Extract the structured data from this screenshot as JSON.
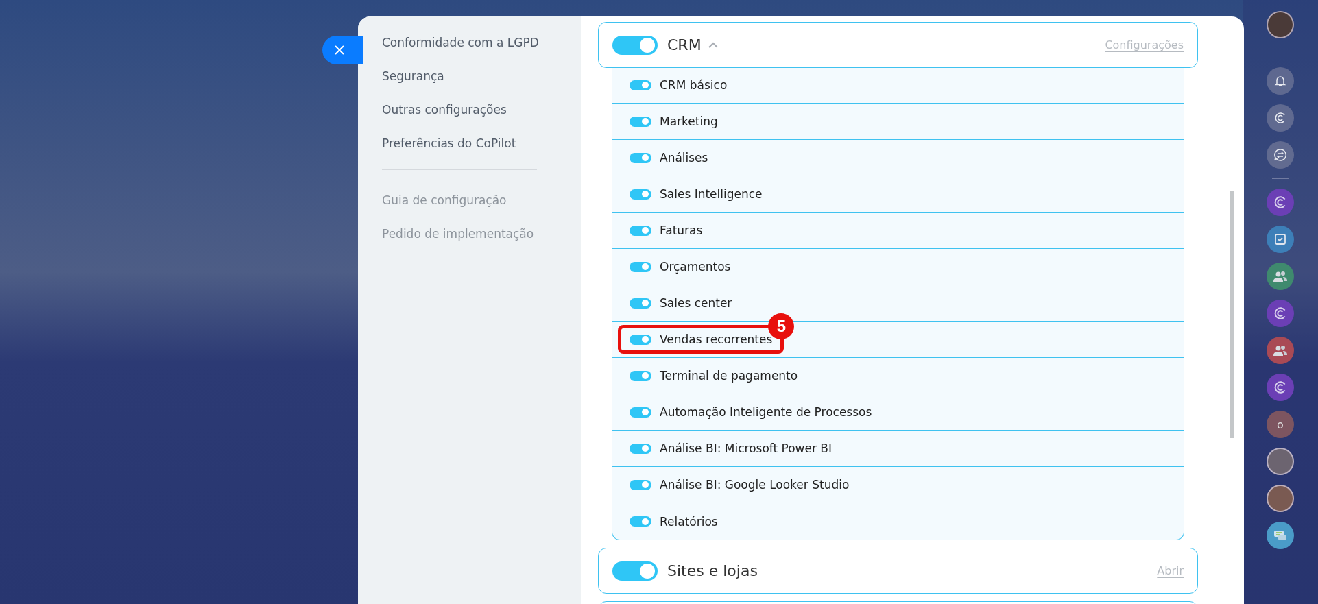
{
  "nav": {
    "items": [
      {
        "label": "Conformidade com a LGPD",
        "muted": false
      },
      {
        "label": "Segurança",
        "muted": false
      },
      {
        "label": "Outras configurações",
        "muted": false
      },
      {
        "label": "Preferências do CoPilot",
        "muted": false
      },
      {
        "label": "Guia de configuração",
        "muted": true
      },
      {
        "label": "Pedido de implementação",
        "muted": true
      }
    ]
  },
  "sections": [
    {
      "title": "CRM",
      "on": true,
      "expanded": true,
      "link": "Configurações",
      "children": [
        {
          "label": "CRM básico",
          "on": true,
          "highlighted": false
        },
        {
          "label": "Marketing",
          "on": true,
          "highlighted": false
        },
        {
          "label": "Análises",
          "on": true,
          "highlighted": false
        },
        {
          "label": "Sales Intelligence",
          "on": true,
          "highlighted": false
        },
        {
          "label": "Faturas",
          "on": true,
          "highlighted": false
        },
        {
          "label": "Orçamentos",
          "on": true,
          "highlighted": false
        },
        {
          "label": "Sales center",
          "on": true,
          "highlighted": false
        },
        {
          "label": "Vendas recorrentes",
          "on": true,
          "highlighted": true,
          "badge": "5"
        },
        {
          "label": "Terminal de pagamento",
          "on": true,
          "highlighted": false
        },
        {
          "label": "Automação Inteligente de Processos",
          "on": true,
          "highlighted": false
        },
        {
          "label": "Análise BI: Microsoft Power BI",
          "on": true,
          "highlighted": false
        },
        {
          "label": "Análise BI: Google Looker Studio",
          "on": true,
          "highlighted": false
        },
        {
          "label": "Relatórios",
          "on": true,
          "highlighted": false
        }
      ]
    },
    {
      "title": "Sites e lojas",
      "on": true,
      "expanded": false,
      "link": "Abrir"
    }
  ],
  "rail": {
    "top": [
      {
        "kind": "avatar"
      },
      {
        "kind": "bell"
      },
      {
        "kind": "copilot"
      },
      {
        "kind": "chat"
      }
    ],
    "items": [
      {
        "kind": "copilot",
        "color": "#6b3fb5"
      },
      {
        "kind": "task",
        "color": "#3d7fb8"
      },
      {
        "kind": "group",
        "color": "#3f8a6e"
      },
      {
        "kind": "copilot",
        "color": "#6b3fb5"
      },
      {
        "kind": "group",
        "color": "#a94a55"
      },
      {
        "kind": "copilot",
        "color": "#6b3fb5"
      },
      {
        "kind": "letter",
        "color": "#7d5560",
        "text": "o"
      },
      {
        "kind": "avatar",
        "color": "#6c6470"
      },
      {
        "kind": "avatar",
        "color": "#7a5a52"
      },
      {
        "kind": "message",
        "color": "#4a9cc8"
      }
    ]
  }
}
